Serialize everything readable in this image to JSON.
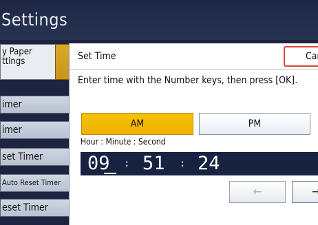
{
  "header": {
    "title": "Settings"
  },
  "left_tabs": [
    {
      "label": "y Paper\nttings"
    }
  ],
  "left_buttons": [
    {
      "label": "imer"
    },
    {
      "label": "imer"
    },
    {
      "label": "set Timer"
    },
    {
      "label": "Auto Reset Timer"
    },
    {
      "label": "eset Timer"
    }
  ],
  "dialog": {
    "title": "Set Time",
    "cancel_label": "Car",
    "instruction": "Enter time with the Number keys, then press [OK].",
    "am_label": "AM",
    "pm_label": "PM",
    "selected_period": "AM",
    "format_label": "Hour : Minute : Second",
    "time": {
      "hour": "09",
      "minute": "51",
      "second": "24",
      "separator": ":"
    },
    "back_arrow": "←",
    "forward_arrow": "→"
  },
  "colors": {
    "accent_selected": "#f4b800",
    "header_bg": "#1d2645",
    "time_display_bg": "#172341",
    "cancel_border": "#d6463f"
  }
}
